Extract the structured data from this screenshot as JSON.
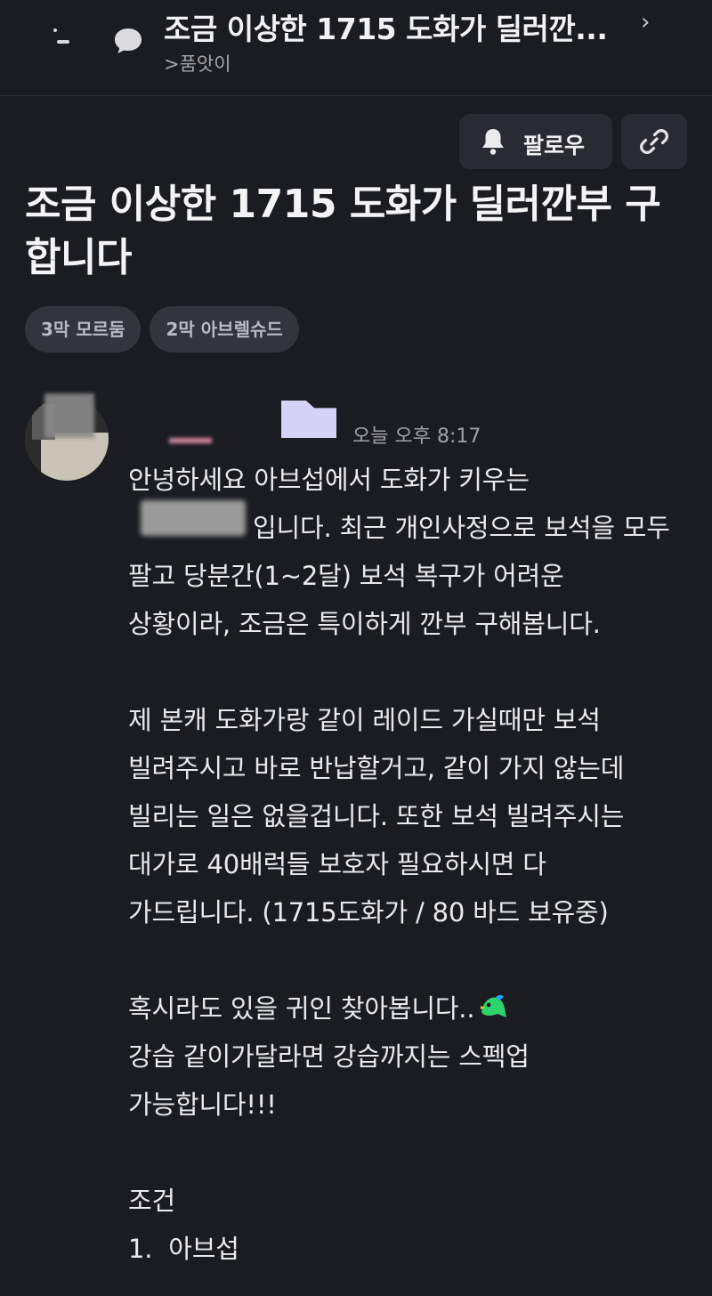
{
  "header": {
    "title": "조금 이상한 1715 도화가 딜러깐...",
    "board": ">품앗이"
  },
  "actions": {
    "follow_label": "팔로우"
  },
  "post": {
    "title": "조금 이상한 1715 도화가 딜러깐부 구합니다",
    "tags": [
      "3막 모르둠",
      "2막 아브렐슈드"
    ],
    "timestamp": "오늘 오후 8:17",
    "body_lines": [
      "안녕하세요 아브섭에서 도화가 키우는",
      "입니다. 최근 개인사정으로 보석을 모두",
      "팔고 당분간(1~2달) 보석 복구가 어려운",
      "상황이라, 조금은 특이하게 깐부 구해봅니다.",
      "",
      "제 본캐 도화가랑 같이 레이드 가실때만 보석",
      "빌려주시고 바로 반납할거고, 같이 가지 않는데",
      "빌리는 일은 없을겁니다. 또한 보석 빌려주시는",
      "대가로 40배럭들 보호자 필요하시면 다",
      "가드립니다. (1715도화가 / 80 바드 보유중)",
      "",
      "혹시라도 있을 귀인 찾아봅니다..",
      "강습 같이가달라면 강습까지는 스펙업",
      "가능합니다!!!",
      "",
      "조건",
      "1.  아브섭"
    ]
  },
  "colors": {
    "background": "#1b1c21",
    "button_bg": "#2a2b32",
    "tag_bg": "#34353c",
    "text_primary": "#eaeaec",
    "text_muted": "#a0a1a8"
  },
  "icons": {
    "back": "back-icon",
    "chat": "chat-bubble-icon",
    "chevron": "chevron-right-icon",
    "bell": "bell-icon",
    "link": "link-icon",
    "emoji": "bird-emoticon"
  }
}
